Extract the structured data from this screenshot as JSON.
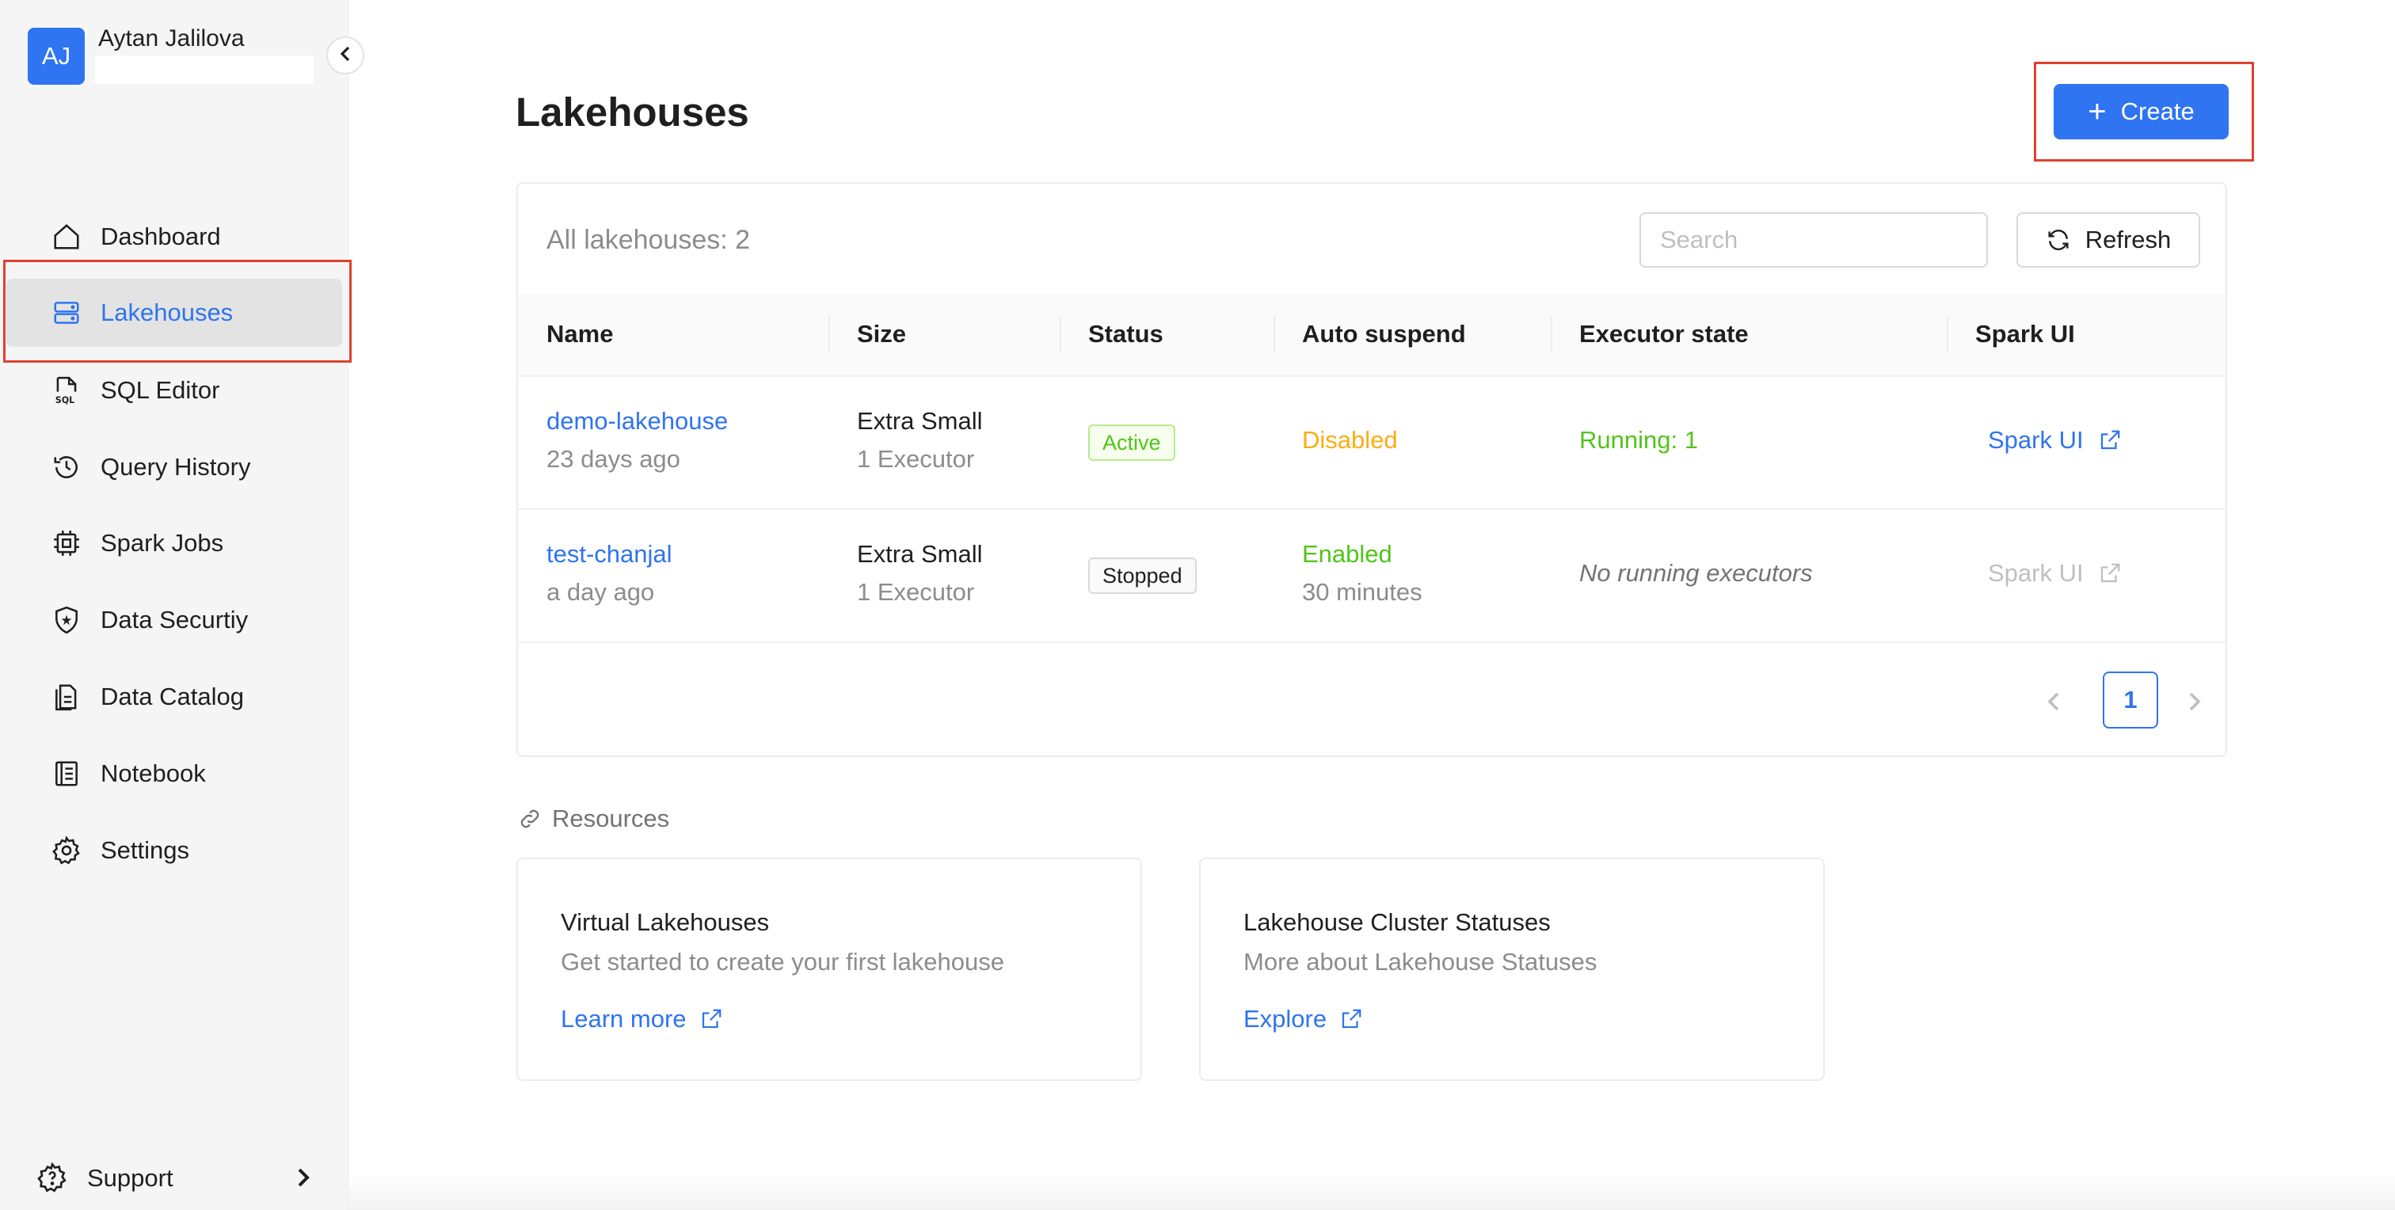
{
  "user": {
    "initials": "AJ",
    "name": "Aytan Jalilova"
  },
  "sidebar": {
    "items": [
      {
        "label": "Dashboard",
        "icon": "home-icon",
        "active": false
      },
      {
        "label": "Lakehouses",
        "icon": "database-icon",
        "active": true
      },
      {
        "label": "SQL Editor",
        "icon": "sql-file-icon",
        "active": false
      },
      {
        "label": "Query History",
        "icon": "history-icon",
        "active": false
      },
      {
        "label": "Spark Jobs",
        "icon": "chip-icon",
        "active": false
      },
      {
        "label": "Data Securtiy",
        "icon": "shield-icon",
        "active": false
      },
      {
        "label": "Data Catalog",
        "icon": "catalog-icon",
        "active": false
      },
      {
        "label": "Notebook",
        "icon": "notebook-icon",
        "active": false
      },
      {
        "label": "Settings",
        "icon": "gear-icon",
        "active": false
      }
    ],
    "support_label": "Support"
  },
  "page": {
    "title": "Lakehouses",
    "create_label": "Create"
  },
  "table_card": {
    "count_label": "All lakehouses: 2",
    "search_placeholder": "Search",
    "refresh_label": "Refresh",
    "columns": [
      "Name",
      "Size",
      "Status",
      "Auto suspend",
      "Executor state",
      "Spark UI"
    ],
    "rows": [
      {
        "name": "demo-lakehouse",
        "created": "23 days ago",
        "size": "Extra Small",
        "executors": "1 Executor",
        "status": "Active",
        "auto_suspend": "Disabled",
        "auto_suspend_detail": "",
        "executor_state": "Running: 1",
        "spark_ui": "Spark UI"
      },
      {
        "name": "test-chanjal",
        "created": "a day ago",
        "size": "Extra Small",
        "executors": "1 Executor",
        "status": "Stopped",
        "auto_suspend": "Enabled",
        "auto_suspend_detail": "30 minutes",
        "executor_state": "No running executors",
        "spark_ui": "Spark UI"
      }
    ],
    "pagination": {
      "current_page": "1"
    }
  },
  "resources": {
    "header": "Resources",
    "cards": [
      {
        "title": "Virtual Lakehouses",
        "description": "Get started to create your first lakehouse",
        "link": "Learn more"
      },
      {
        "title": "Lakehouse Cluster Statuses",
        "description": "More about Lakehouse Statuses",
        "link": "Explore"
      }
    ]
  },
  "colors": {
    "accent": "#2f74f0",
    "highlight": "#e0412f",
    "active_green": "#52c41a",
    "warning_orange": "#faad14"
  }
}
